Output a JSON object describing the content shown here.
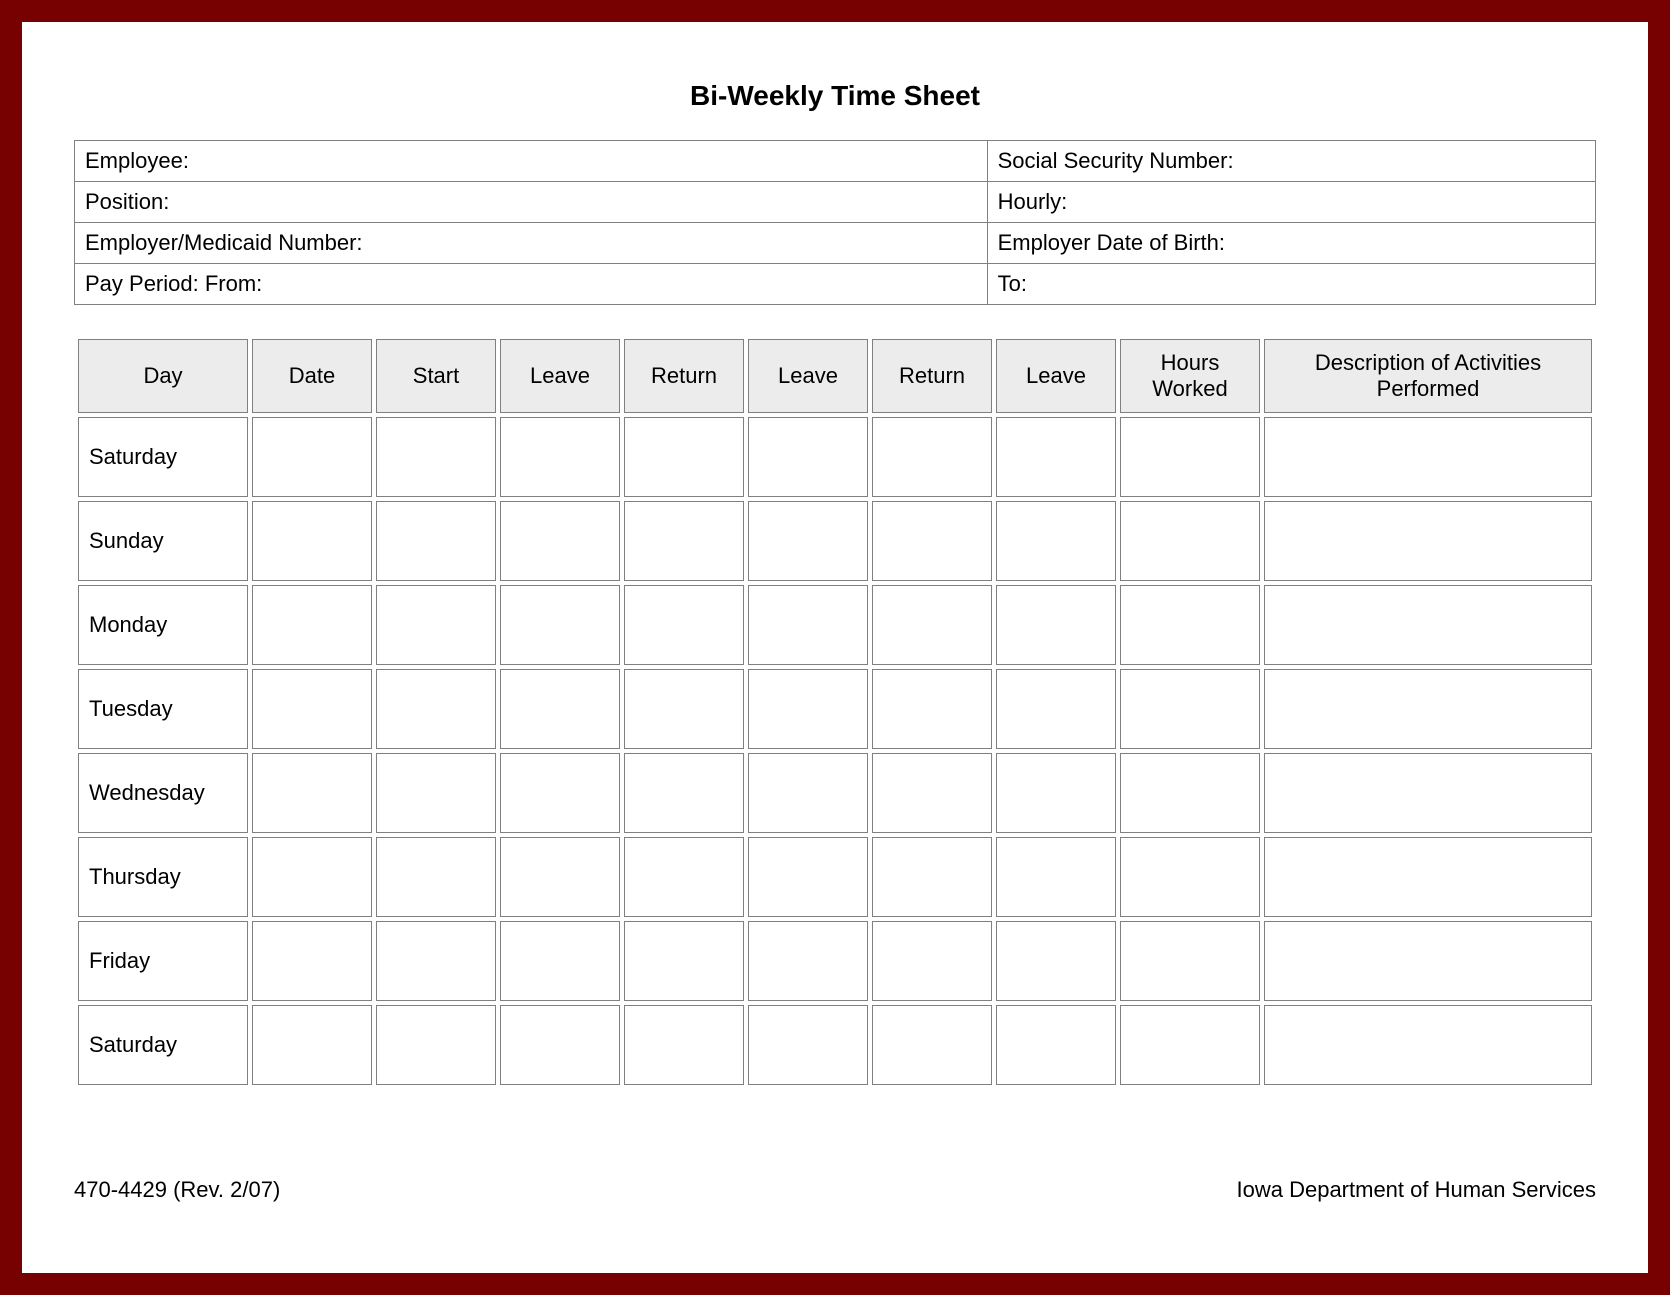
{
  "title": "Bi-Weekly Time Sheet",
  "info": {
    "employee_label": "Employee:",
    "ssn_label": "Social Security Number:",
    "position_label": "Position:",
    "hourly_label": "Hourly:",
    "employer_medicaid_label": "Employer/Medicaid Number:",
    "employer_dob_label": "Employer Date of Birth:",
    "pay_period_from_label": "Pay Period:  From:",
    "pay_period_to_label": "To:"
  },
  "columns": {
    "day": "Day",
    "date": "Date",
    "start": "Start",
    "leave1": "Leave",
    "return1": "Return",
    "leave2": "Leave",
    "return2": "Return",
    "leave3": "Leave",
    "hours": "Hours Worked",
    "desc": "Description of Activities Performed"
  },
  "rows": [
    {
      "day": "Saturday"
    },
    {
      "day": "Sunday"
    },
    {
      "day": "Monday"
    },
    {
      "day": "Tuesday"
    },
    {
      "day": "Wednesday"
    },
    {
      "day": "Thursday"
    },
    {
      "day": "Friday"
    },
    {
      "day": "Saturday"
    }
  ],
  "footer": {
    "form_number": "470-4429  (Rev. 2/07)",
    "department": "Iowa Department of Human Services"
  }
}
